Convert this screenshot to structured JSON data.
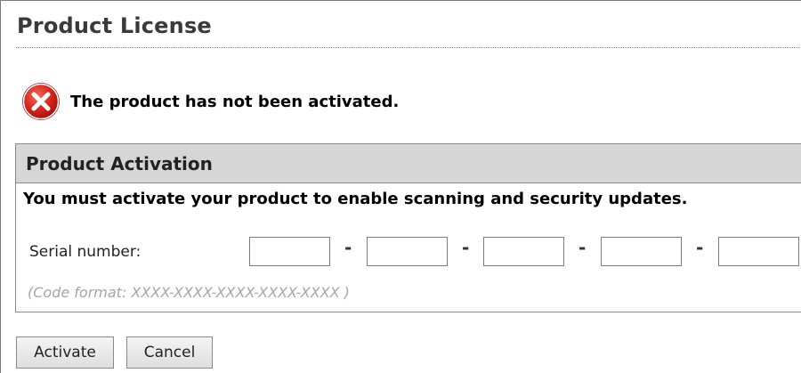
{
  "page": {
    "title": "Product License"
  },
  "status": {
    "icon": "error-icon",
    "message": "The product has not been activated."
  },
  "activation": {
    "header": "Product Activation",
    "notice": "You must activate your product to enable scanning and security updates.",
    "serial_label": "Serial number:",
    "serial_segments": [
      "",
      "",
      "",
      "",
      ""
    ],
    "separator": "-",
    "format_hint": "(Code format: XXXX-XXXX-XXXX-XXXX-XXXX )"
  },
  "buttons": {
    "activate": "Activate",
    "cancel": "Cancel"
  },
  "colors": {
    "error_red": "#d8261c",
    "panel_header_bg": "#d6d6d6",
    "hint_gray": "#a6a6a6"
  }
}
